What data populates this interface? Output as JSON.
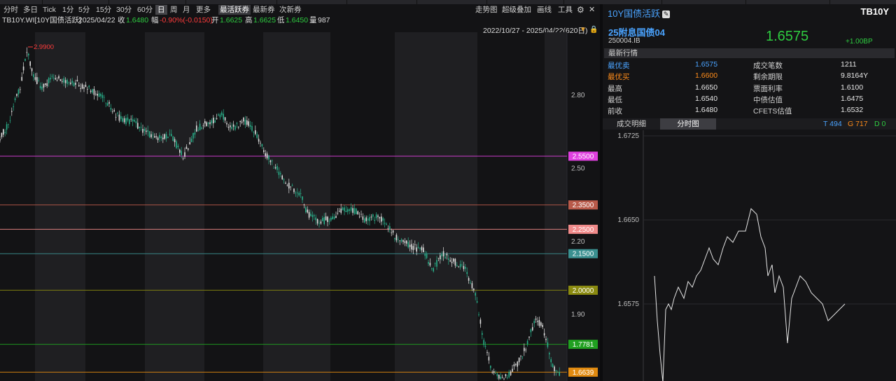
{
  "toolbar": {
    "periods": [
      "分时",
      "多日",
      "Tick",
      "1分",
      "5分",
      "15分",
      "30分",
      "60分",
      "日",
      "周",
      "月",
      "更多"
    ],
    "active_period": "日",
    "modes": [
      "最活跃券",
      "最新券",
      "次新券"
    ],
    "active_mode": "最活跃券",
    "tools": [
      "走势图",
      "超级叠加",
      "画线",
      "工具"
    ]
  },
  "info": {
    "symbol": "TB10Y.WI[10Y国债活跃]",
    "date": "2025/04/22",
    "close_label": "收",
    "close": "1.6480",
    "change_label": "幅",
    "change": "-0.90%(-0.0150)",
    "open_label": "开",
    "open": "1.6625",
    "high_label": "高",
    "high": "1.6625",
    "low_label": "低",
    "low": "1.6450",
    "volume_label": "量",
    "volume": "987"
  },
  "range": "2022/10/27 - 2025/04/22(620日)",
  "kline": {
    "y_ticks": [
      "2.80",
      "2.50",
      "2.20",
      "1.90"
    ],
    "peak_label": "2.9900",
    "level_labels": [
      {
        "value": "2.5500",
        "color": "#e040e0"
      },
      {
        "value": "2.3500",
        "color": "#b85a4a"
      },
      {
        "value": "2.2500",
        "color": "#f08a8a"
      },
      {
        "value": "2.1500",
        "color": "#3a9090"
      },
      {
        "value": "2.0000",
        "color": "#8a8a10"
      },
      {
        "value": "1.7781",
        "color": "#20a020"
      },
      {
        "value": "1.6639",
        "color": "#e08a10"
      }
    ]
  },
  "panel": {
    "title": "10Y国债活跃",
    "code": "TB10Y",
    "bond_name": "25附息国债04",
    "bond_id": "250004.IB",
    "price": "1.6575",
    "change_bp": "+1.00BP",
    "section": "最新行情",
    "quotes_left": [
      {
        "label": "最优卖",
        "value": "1.6575",
        "style": "blue"
      },
      {
        "label": "最优买",
        "value": "1.6600",
        "style": "orange"
      },
      {
        "label": "最高",
        "value": "1.6650",
        "style": "plain"
      },
      {
        "label": "最低",
        "value": "1.6540",
        "style": "plain"
      },
      {
        "label": "前收",
        "value": "1.6480",
        "style": "plain"
      }
    ],
    "quotes_right": [
      {
        "label": "成交笔数",
        "value": "1211"
      },
      {
        "label": "剩余期限",
        "value": "9.8164Y"
      },
      {
        "label": "票面利率",
        "value": "1.6100"
      },
      {
        "label": "中债估值",
        "value": "1.6475"
      },
      {
        "label": "CFETS估值",
        "value": "1.6532"
      }
    ],
    "tabs": [
      "成交明细",
      "分时图"
    ],
    "active_tab": "分时图",
    "count_t": "T 494",
    "count_g": "G 717",
    "count_d": "D 0",
    "intraday_ticks": [
      "1.6725",
      "1.6650",
      "1.6575"
    ]
  },
  "colors": {
    "up": "#ff3b3b",
    "down": "#2ecc40",
    "accent": "#4aa3ff"
  }
}
